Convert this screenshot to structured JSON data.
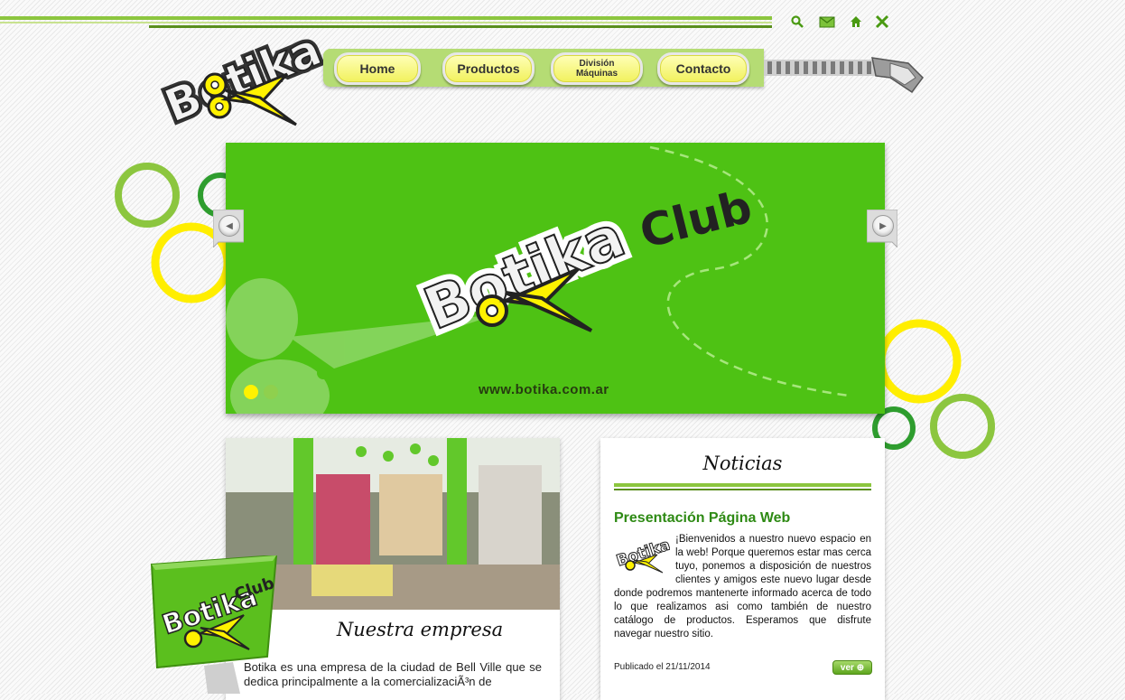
{
  "header": {
    "logo_text": "Botika",
    "tools": [
      {
        "name": "search-icon",
        "label": "Buscar"
      },
      {
        "name": "mail-icon",
        "label": "Contacto"
      },
      {
        "name": "home-icon",
        "label": "Inicio"
      },
      {
        "name": "sitemap-icon",
        "label": "Mapa"
      }
    ]
  },
  "nav": {
    "home": "Home",
    "productos": "Productos",
    "division_line1": "División",
    "division_line2": "Máquinas",
    "contacto": "Contacto"
  },
  "slider": {
    "logo_text": "Botika",
    "club_text": "Club",
    "url": "www.botika.com.ar",
    "prev_label": "◀",
    "next_label": "▶"
  },
  "empresa": {
    "title": "Nuestra empresa",
    "text": "Botika es una empresa de la ciudad de Bell Ville que se dedica principalmente a la comercializaciÃ³n de"
  },
  "noticias": {
    "title": "Noticias",
    "news_title": "Presentación Página Web",
    "body": "¡Bienvenidos a nuestro nuevo espacio en la web! Porque queremos estar mas cerca tuyo, ponemos a disposición de nuestros clientes y amigos este nuevo lugar desde donde podremos mantenerte informado acerca de todo lo que realizamos asi como también de nuestro catálogo de productos. Esperamos que disfrute navegar nuestro sitio.",
    "date": "Publicado el 21/11/2014",
    "ver": "ver"
  },
  "sign": {
    "logo_text": "Botika",
    "club_text": "Club"
  },
  "colors": {
    "brand_green": "#4ec214",
    "brand_yellow": "#ffee00",
    "nav_green": "#b5dc74",
    "news_title_green": "#2e8a14"
  }
}
